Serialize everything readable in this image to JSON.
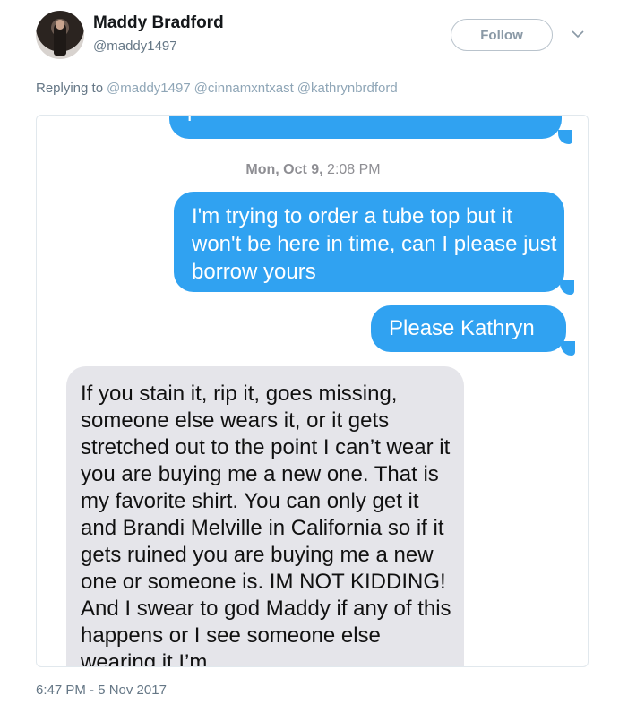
{
  "user": {
    "display_name": "Maddy Bradford",
    "handle": "@maddy1497"
  },
  "follow_label": "Follow",
  "reply": {
    "prefix": "Replying to",
    "mentions": [
      "@maddy1497",
      "@cinnamxntxast",
      "@kathrynbrdford"
    ]
  },
  "screenshot": {
    "clipped_top_text": "pictures",
    "timestamp_day": "Mon, Oct 9,",
    "timestamp_time": "2:08 PM",
    "sent_1": "I'm trying to order a tube top but it won't be here in time, can I please just borrow yours",
    "sent_2": "Please Kathryn",
    "received": "If you stain it, rip it, goes missing, someone else wears it, or it gets stretched out to the point I can’t wear it you are buying me a new one. That is my favorite shirt. You can only get it and Brandi Melville in California so if it gets ruined you are buying me a new one or someone is. IM NOT KIDDING! And I swear to god Maddy if any of this happens or I see someone else wearing it I’m"
  },
  "tweet_time": "6:47 PM - 5 Nov 2017",
  "colors": {
    "imessage_blue": "#30a2f1",
    "imessage_gray": "#e5e5ea",
    "link_muted": "#8fa6b7"
  }
}
